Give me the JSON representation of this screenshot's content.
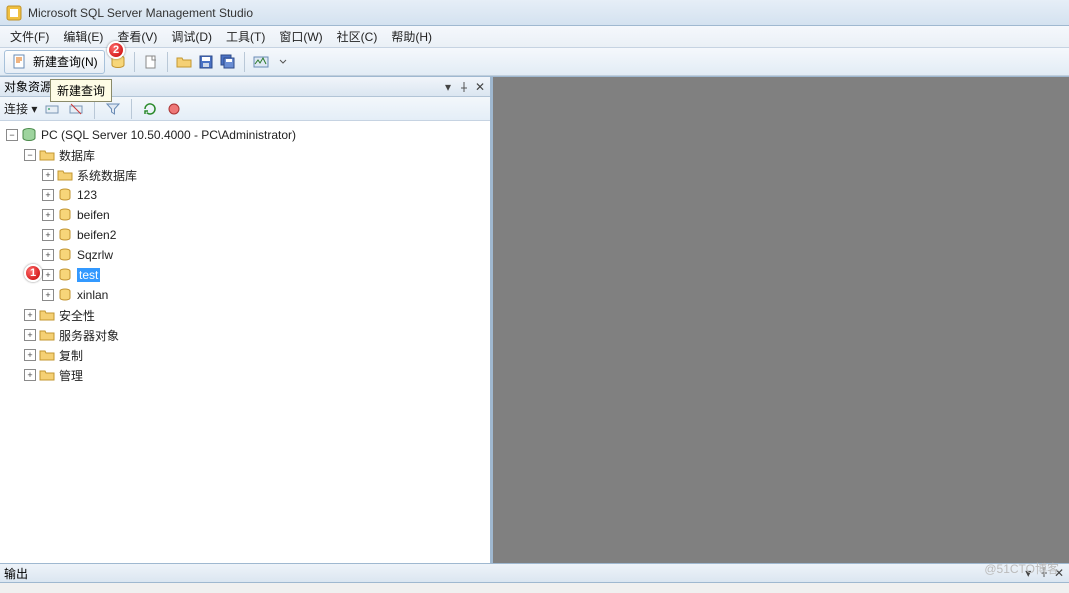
{
  "window": {
    "title": "Microsoft SQL Server Management Studio"
  },
  "menu": {
    "file": "文件(F)",
    "edit": "编辑(E)",
    "view": "查看(V)",
    "debug": "调试(D)",
    "tools": "工具(T)",
    "window": "窗口(W)",
    "community": "社区(C)",
    "help": "帮助(H)"
  },
  "toolbar": {
    "new_query": "新建查询(N)",
    "tooltip_new_query": "新建查询"
  },
  "markers": {
    "m1": "1",
    "m2": "2"
  },
  "object_explorer": {
    "title": "对象资源管理器",
    "connect_label": "连接 ▾"
  },
  "tree": {
    "server": "PC (SQL Server 10.50.4000 - PC\\Administrator)",
    "databases": "数据库",
    "sysdb": "系统数据库",
    "db_123": "123",
    "db_beifen": "beifen",
    "db_beifen2": "beifen2",
    "db_sqzrlw": "Sqzrlw",
    "db_test": "test",
    "db_xinlan": "xinlan",
    "security": "安全性",
    "server_objects": "服务器对象",
    "replication": "复制",
    "management": "管理"
  },
  "output": {
    "title": "输出"
  },
  "watermark": "@51CTO博客"
}
